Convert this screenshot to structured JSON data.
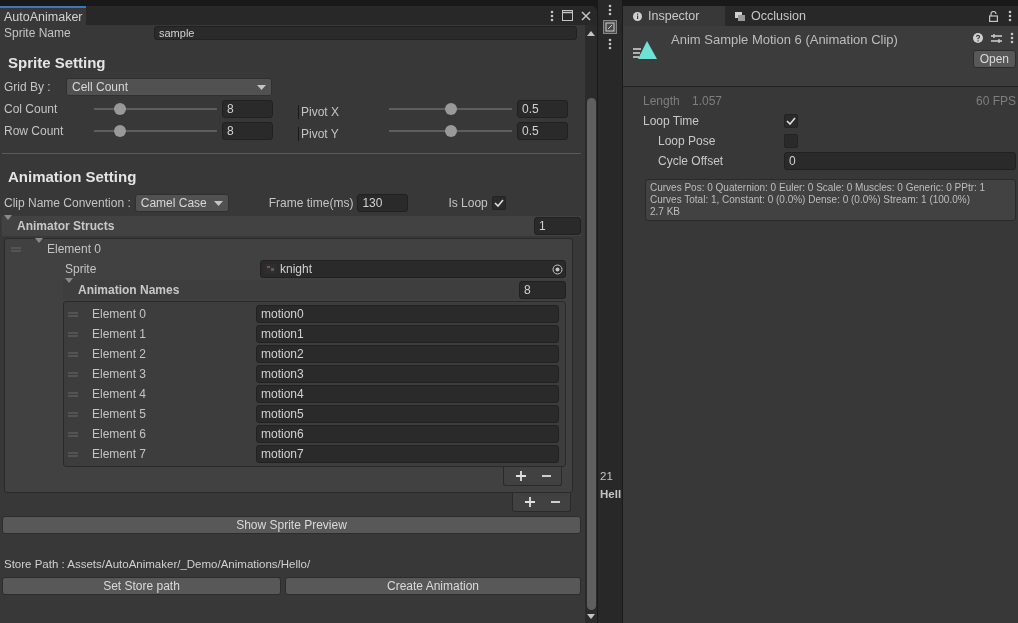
{
  "left_panel": {
    "tab": "AutoAnimaker",
    "sprite_name": {
      "label": "Sprite Name",
      "value": "sample"
    },
    "sprite_setting": {
      "heading": "Sprite Setting",
      "grid_by": {
        "label": "Grid By :",
        "value": "Cell Count"
      },
      "sliders": [
        {
          "label": "Col Count",
          "level": 0.18,
          "value": "8"
        },
        {
          "label": "Pivot X",
          "level": 0.5,
          "value": "0.5"
        },
        {
          "label": "Row Count",
          "level": 0.18,
          "value": "8"
        },
        {
          "label": "Pivot Y",
          "level": 0.5,
          "value": "0.5"
        }
      ]
    },
    "animation_setting": {
      "heading": "Animation Setting",
      "clip_name_convention": {
        "label": "Clip Name Convention :",
        "value": "Camel Case"
      },
      "frame_time": {
        "label": "Frame time(ms)",
        "value": "130"
      },
      "is_loop": {
        "label": "Is Loop",
        "checked": true
      }
    },
    "animator_structs": {
      "label": "Animator Structs",
      "count": "1",
      "expanded": true,
      "elements": [
        {
          "label": "Element 0",
          "expanded": true,
          "sprite": {
            "label": "Sprite",
            "value": "knight"
          },
          "animation_names": {
            "label": "Animation Names",
            "count": "8",
            "expanded": true,
            "items": [
              {
                "label": "Element 0",
                "value": "motion0"
              },
              {
                "label": "Element 1",
                "value": "motion1"
              },
              {
                "label": "Element 2",
                "value": "motion2"
              },
              {
                "label": "Element 3",
                "value": "motion3"
              },
              {
                "label": "Element 4",
                "value": "motion4"
              },
              {
                "label": "Element 5",
                "value": "motion5"
              },
              {
                "label": "Element 6",
                "value": "motion6"
              },
              {
                "label": "Element 7",
                "value": "motion7"
              }
            ]
          }
        }
      ]
    },
    "preview_button": "Show Sprite Preview",
    "store_path": "Store Path : Assets/AutoAnimaker/_Demo/Animations/Hello/",
    "buttons": [
      "Set Store path",
      "Create Animation"
    ]
  },
  "middle_strip": {
    "texts": [
      "21",
      "Hell"
    ]
  },
  "inspector": {
    "tabs": [
      {
        "label": "Inspector",
        "selected": true
      },
      {
        "label": "Occlusion",
        "selected": false
      }
    ],
    "title": "Anim Sample Motion 6 (Animation Clip)",
    "open_button": "Open",
    "length": {
      "label": "Length",
      "value": "1.057"
    },
    "fps": "60 FPS",
    "fields": [
      {
        "kind": "checkbox",
        "label": "Loop Time",
        "checked": true,
        "indented": false
      },
      {
        "kind": "checkbox",
        "label": "Loop Pose",
        "checked": false,
        "indented": true
      },
      {
        "kind": "text",
        "label": "Cycle Offset",
        "value": "0",
        "indented": true
      }
    ],
    "info": [
      "Curves Pos: 0 Quaternion: 0 Euler: 0 Scale: 0 Muscles: 0 Generic: 0 PPtr: 1",
      "Curves Total: 1, Constant: 0 (0.0%) Dense: 0 (0.0%) Stream: 1 (100.0%)",
      "2.7 KB"
    ]
  }
}
